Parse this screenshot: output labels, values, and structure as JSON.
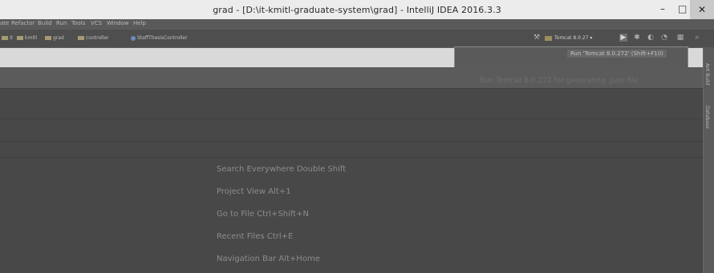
{
  "window": {
    "title": "grad - [D:\\it-kmitl-graduate-system\\grad] - IntelliJ IDEA 2016.3.3",
    "minimize_glyph": "–",
    "maximize_glyph": "□",
    "close_glyph": "✕"
  },
  "menu": {
    "items": [
      "ate",
      "Refactor",
      "Build",
      "Run",
      "Tools",
      "VCS",
      "Window",
      "Help"
    ]
  },
  "navbar": {
    "crumbs": [
      "it",
      "kmitl",
      "grad",
      "controller",
      "StaffThesisController"
    ]
  },
  "toolbar": {
    "run_config": "Tomcat 8.0.27",
    "tooltip": "Run 'Tomcat 8.0.272' (Shift+F10)"
  },
  "editor": {
    "top_hint": "Run Tomcat 8.0.272 for generating .json file"
  },
  "right_stripe": {
    "labels": [
      "Ant Build",
      "Database"
    ]
  },
  "empty_hints": [
    "Search Everywhere  Double Shift",
    "Project View  Alt+1",
    "Go to File  Ctrl+Shift+N",
    "Recent Files  Ctrl+E",
    "Navigation Bar  Alt+Home"
  ]
}
